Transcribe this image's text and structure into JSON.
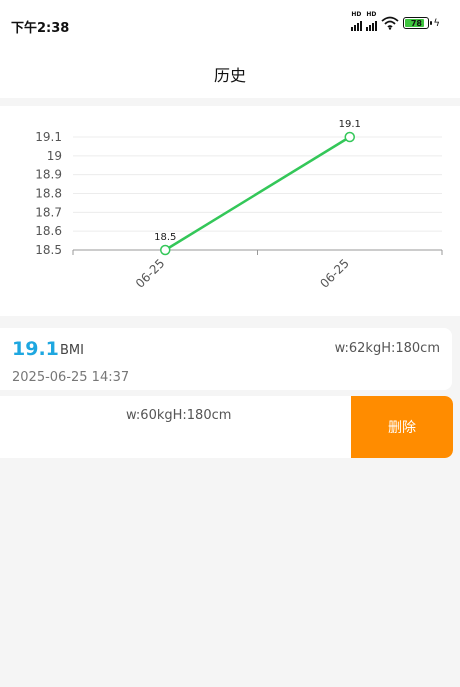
{
  "status_bar": {
    "time": "下午2:38",
    "signal_badge": "HD",
    "battery_level": "78",
    "icons": [
      "signal-icon",
      "signal-icon",
      "wifi-icon",
      "battery-icon",
      "charging-icon"
    ]
  },
  "header": {
    "title": "历史"
  },
  "chart_data": {
    "type": "line",
    "categories": [
      "06-25",
      "06-25"
    ],
    "values": [
      18.5,
      19.1
    ],
    "data_labels": [
      "18.5",
      "19.1"
    ],
    "y_ticks": [
      "18.5",
      "18.6",
      "18.7",
      "18.8",
      "18.9",
      "19",
      "19.1"
    ],
    "ylim": [
      18.5,
      19.1
    ],
    "title": "",
    "xlabel": "",
    "ylabel": "",
    "grid": true,
    "line_color": "#34c759"
  },
  "records": [
    {
      "bmi": "19.1",
      "bmi_unit": "BMI",
      "weight_height": "w:62kgH:180cm",
      "datetime": "2025-06-25 14:37"
    },
    {
      "weight_height": "w:60kgH:180cm",
      "delete_label": "删除"
    }
  ],
  "colors": {
    "bmi_accent": "#1ea7e0",
    "delete_button": "#ff8c00",
    "background": "#f5f5f5"
  }
}
